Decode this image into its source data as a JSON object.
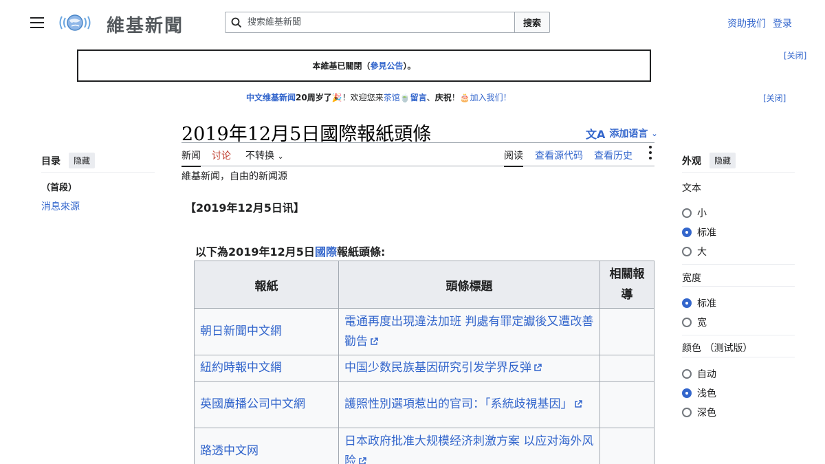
{
  "header": {
    "logo_text": "維基新聞",
    "search_placeholder": "搜索維基新聞",
    "search_button": "搜索",
    "donate": "资助我们",
    "login": "登录"
  },
  "notices": {
    "closed_notice_pre": "本維基已關閉（",
    "closed_notice_link": "參見公告",
    "closed_notice_post": "）。",
    "close_label": "[关闭]",
    "anniv_link": "中文维基新闻",
    "anniv_text1": "20周岁了",
    "anniv_text2": "！欢迎您来",
    "anniv_teahouse": "茶馆",
    "anniv_message": "留言",
    "anniv_text3": "、",
    "anniv_celebrate": "庆祝",
    "anniv_text4": "！",
    "anniv_join": "加入我们！"
  },
  "page": {
    "title": "2019年12月5日國際報紙頭條",
    "add_languages": "添加语言",
    "tabs": {
      "article": "新闻",
      "talk": "讨论",
      "variant": "不转换",
      "read": "阅读",
      "view_source": "查看源代码",
      "history": "查看历史"
    },
    "tagline": "維基新闻，自由的新闻源",
    "dateline": "【2019年12月5日讯】",
    "intro_pre": "以下為2019年12月5日",
    "intro_link": "國際",
    "intro_post": "報紙頭條:"
  },
  "table": {
    "headers": [
      "報紙",
      "頭條標題",
      "相關報導"
    ],
    "rows": [
      {
        "paper": "朝日新聞中文網",
        "headline": "電通再度出現違法加班 判處有罪定讞後又遭改善勸告"
      },
      {
        "paper": "紐約時報中文網",
        "headline": "中国少数民族基因研究引发学界反弹"
      },
      {
        "paper": "英國廣播公司中文網",
        "headline": "護照性別選項惹出的官司：「系統歧視基因」"
      },
      {
        "paper": "路透中文网",
        "headline": "日本政府批准大规模经济刺激方案 以应对海外风险"
      }
    ]
  },
  "toc": {
    "title": "目录",
    "hide": "隐藏",
    "items": [
      "（首段）",
      "消息來源"
    ]
  },
  "appearance": {
    "title": "外观",
    "hide": "隐藏",
    "text_label": "文本",
    "text_options": [
      "小",
      "标准",
      "大"
    ],
    "text_selected": "标准",
    "width_label": "宽度",
    "width_options": [
      "标准",
      "宽"
    ],
    "width_selected": "标准",
    "color_label": "颜色 （测试版）",
    "color_options": [
      "自动",
      "浅色",
      "深色"
    ],
    "color_selected": "浅色"
  },
  "colors": {
    "link": "#3366cc",
    "talk_red": "#bf3c2c",
    "header_bg": "#eaecf0"
  }
}
